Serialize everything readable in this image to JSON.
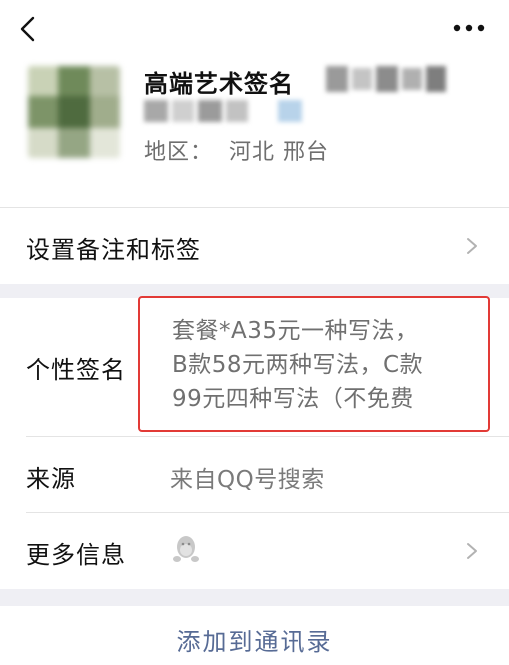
{
  "nav": {
    "back_icon": "chevron-left-icon",
    "more_icon": "more-horizontal-icon"
  },
  "profile": {
    "nickname": "高端艺术签名",
    "region_label": "地区：",
    "region_value": "河北 邢台"
  },
  "rows": {
    "remark": {
      "label": "设置备注和标签"
    },
    "signature": {
      "label": "个性签名",
      "value": "套餐*A35元一种写法，\nB款58元两种写法，C款\n99元四种写法（不免费"
    },
    "source": {
      "label": "来源",
      "value": "来自QQ号搜索"
    },
    "more_info": {
      "label": "更多信息",
      "icon": "qq-penguin-icon"
    }
  },
  "actions": {
    "add_contact": "添加到通讯录"
  },
  "colors": {
    "highlight_border": "#e23a36",
    "link_blue": "#576b95",
    "section_bg": "#efeff4"
  }
}
